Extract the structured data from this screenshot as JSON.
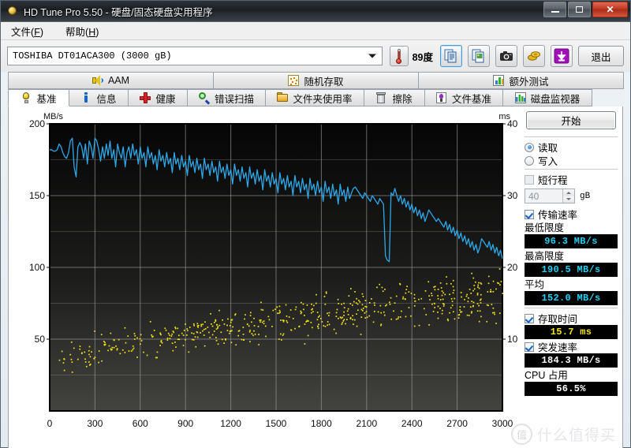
{
  "window": {
    "title": "HD Tune Pro 5.50 - 硬盘/固态硬盘实用程序",
    "icon": "bulb-icon",
    "minimize_label": "–",
    "maximize_label": "□",
    "close_label": "✕"
  },
  "menu": {
    "items": [
      {
        "label": "文件",
        "accel": "F"
      },
      {
        "label": "帮助",
        "accel": "H"
      }
    ]
  },
  "toolbar": {
    "drive": "TOSHIBA  DT01ACA300  (3000  gB)",
    "temperature": "89度",
    "buttons": [
      {
        "name": "copy-icon",
        "glyph": "copy"
      },
      {
        "name": "copy-image-icon",
        "glyph": "copy-image"
      },
      {
        "name": "screenshot-camera-icon",
        "glyph": "camera"
      },
      {
        "name": "coins-icon",
        "glyph": "coins"
      },
      {
        "name": "download-icon",
        "glyph": "download"
      }
    ],
    "exit_label": "退出"
  },
  "tabs": {
    "top_row": [
      {
        "label": "AAM",
        "icon": "speaker-icon",
        "active": false
      },
      {
        "label": "随机存取",
        "icon": "random-access-icon",
        "active": false
      },
      {
        "label": "额外测试",
        "icon": "extra-tests-icon",
        "active": false
      }
    ],
    "bottom_row": [
      {
        "label": "基准",
        "icon": "bulb-icon",
        "active": true
      },
      {
        "label": "信息",
        "icon": "info-icon",
        "active": false
      },
      {
        "label": "健康",
        "icon": "health-cross-icon",
        "active": false
      },
      {
        "label": "错误扫描",
        "icon": "magnifier-icon",
        "active": false
      },
      {
        "label": "文件夹使用率",
        "icon": "folder-icon",
        "active": false
      },
      {
        "label": "擦除",
        "icon": "trash-icon",
        "active": false
      },
      {
        "label": "文件基准",
        "icon": "file-benchmark-icon",
        "active": false
      },
      {
        "label": "磁盘监视器",
        "icon": "disk-monitor-icon",
        "active": false
      }
    ]
  },
  "panel": {
    "start_label": "开始",
    "mode_read": "读取",
    "mode_write": "写入",
    "mode_selected": "读取",
    "short_stroke_label": "短行程",
    "short_stroke_checked": false,
    "short_stroke_value": "40",
    "short_stroke_unit": "gB",
    "transfer_rate_label": "传输速率",
    "transfer_rate_checked": true,
    "min_label": "最低限度",
    "min_value": "96.3 MB/s",
    "max_label": "最高限度",
    "max_value": "190.5 MB/s",
    "avg_label": "平均",
    "avg_value": "152.0 MB/s",
    "access_time_label": "存取时间",
    "access_time_checked": true,
    "access_time_value": "15.7 ms",
    "burst_rate_label": "突发速率",
    "burst_rate_checked": true,
    "burst_rate_value": "184.3 MB/s",
    "cpu_label": "CPU 占用",
    "cpu_value": "56.5%"
  },
  "watermark": {
    "text": "什么值得买",
    "mark": "值"
  },
  "colors": {
    "transfer_line": "#2ca8e8",
    "access_dots": "#f2e219",
    "plot_bg_top": "#060606",
    "plot_bg_bottom": "#43433f",
    "grid": "#9a9a9a"
  },
  "chart_data": {
    "type": "line",
    "title": "",
    "xlabel": "",
    "ylabel": "MB/s",
    "y2label": "ms",
    "xlim": [
      0,
      3000
    ],
    "ylim": [
      0,
      200
    ],
    "y2lim": [
      0,
      40
    ],
    "grid": true,
    "xticks": [
      0,
      300,
      600,
      900,
      1200,
      1500,
      1800,
      2100,
      2400,
      2700,
      3000
    ],
    "yticks": [
      0,
      50,
      100,
      150,
      200
    ],
    "y2ticks": [
      0,
      10,
      20,
      30,
      40
    ],
    "series": [
      {
        "name": "传输速率",
        "axis": "left",
        "unit": "MB/s",
        "color": "#2ca8e8",
        "render": "line",
        "x": [
          0,
          12,
          25,
          37,
          50,
          62,
          75,
          87,
          100,
          112,
          125,
          137,
          150,
          162,
          175,
          187,
          200,
          212,
          225,
          237,
          250,
          262,
          275,
          287,
          300,
          312,
          325,
          337,
          350,
          362,
          375,
          387,
          400,
          412,
          425,
          437,
          450,
          462,
          475,
          487,
          500,
          512,
          525,
          537,
          550,
          562,
          575,
          587,
          600,
          612,
          625,
          637,
          650,
          662,
          675,
          687,
          700,
          712,
          725,
          737,
          750,
          762,
          775,
          787,
          800,
          812,
          825,
          837,
          850,
          862,
          875,
          887,
          900,
          912,
          925,
          937,
          950,
          962,
          975,
          987,
          1000,
          1012,
          1025,
          1037,
          1050,
          1062,
          1075,
          1087,
          1100,
          1112,
          1125,
          1137,
          1150,
          1162,
          1175,
          1187,
          1200,
          1212,
          1225,
          1237,
          1250,
          1262,
          1275,
          1287,
          1300,
          1312,
          1325,
          1337,
          1350,
          1362,
          1375,
          1387,
          1400,
          1412,
          1425,
          1437,
          1450,
          1462,
          1475,
          1487,
          1500,
          1512,
          1525,
          1537,
          1550,
          1562,
          1575,
          1587,
          1600,
          1612,
          1625,
          1637,
          1650,
          1662,
          1675,
          1687,
          1700,
          1712,
          1725,
          1737,
          1750,
          1762,
          1775,
          1787,
          1800,
          1812,
          1825,
          1837,
          1850,
          1862,
          1875,
          1887,
          1900,
          1912,
          1925,
          1937,
          1950,
          1962,
          1975,
          1987,
          2000,
          2012,
          2025,
          2037,
          2050,
          2062,
          2075,
          2087,
          2100,
          2112,
          2125,
          2137,
          2150,
          2162,
          2175,
          2187,
          2200,
          2212,
          2225,
          2237,
          2250,
          2262,
          2275,
          2287,
          2300,
          2312,
          2325,
          2337,
          2350,
          2362,
          2375,
          2387,
          2400,
          2412,
          2425,
          2437,
          2450,
          2462,
          2475,
          2487,
          2500,
          2512,
          2525,
          2537,
          2550,
          2562,
          2575,
          2587,
          2600,
          2612,
          2625,
          2637,
          2650,
          2662,
          2675,
          2687,
          2700,
          2712,
          2725,
          2737,
          2750,
          2762,
          2775,
          2787,
          2800,
          2812,
          2825,
          2837,
          2850,
          2862,
          2875,
          2887,
          2900,
          2912,
          2925,
          2937,
          2950,
          2962,
          2975,
          2987,
          3000
        ],
        "values": [
          182,
          182,
          181,
          181,
          182,
          186,
          184,
          180,
          177,
          176,
          180,
          188,
          190,
          170,
          163,
          184,
          187,
          184,
          176,
          186,
          172,
          188,
          184,
          176,
          190,
          188,
          182,
          174,
          184,
          176,
          186,
          178,
          188,
          176,
          182,
          170,
          186,
          180,
          176,
          184,
          170,
          180,
          184,
          176,
          186,
          178,
          182,
          172,
          184,
          176,
          180,
          170,
          184,
          176,
          180,
          172,
          178,
          168,
          182,
          174,
          178,
          170,
          180,
          172,
          176,
          166,
          180,
          172,
          176,
          168,
          178,
          170,
          174,
          164,
          178,
          170,
          174,
          166,
          176,
          168,
          172,
          162,
          176,
          168,
          172,
          164,
          174,
          166,
          170,
          160,
          174,
          166,
          170,
          162,
          172,
          164,
          168,
          158,
          172,
          164,
          168,
          160,
          170,
          162,
          166,
          156,
          170,
          162,
          166,
          158,
          168,
          160,
          164,
          154,
          168,
          160,
          164,
          156,
          166,
          158,
          162,
          152,
          166,
          158,
          162,
          154,
          164,
          156,
          160,
          150,
          164,
          156,
          160,
          152,
          162,
          154,
          158,
          148,
          162,
          154,
          158,
          150,
          160,
          152,
          156,
          146,
          160,
          152,
          156,
          148,
          158,
          150,
          154,
          144,
          158,
          150,
          154,
          146,
          156,
          148,
          152,
          155,
          156,
          154,
          152,
          150,
          148,
          152,
          150,
          148,
          146,
          150,
          148,
          146,
          144,
          148,
          146,
          144,
          108,
          105,
          104,
          152,
          150,
          155,
          150,
          146,
          150,
          144,
          148,
          142,
          146,
          140,
          144,
          138,
          142,
          136,
          140,
          134,
          138,
          132,
          136,
          140,
          138,
          136,
          134,
          132,
          134,
          132,
          130,
          128,
          132,
          126,
          130,
          124,
          128,
          122,
          126,
          120,
          124,
          118,
          122,
          116,
          120,
          114,
          118,
          112,
          116,
          110,
          114,
          120,
          118,
          116,
          114,
          118,
          112,
          116,
          110,
          114,
          108,
          112,
          106,
          110,
          104,
          108,
          102,
          106,
          100,
          104,
          98,
          102,
          97,
          100,
          98,
          97
        ]
      },
      {
        "name": "存取时间",
        "axis": "right",
        "unit": "ms",
        "color": "#f2e219",
        "render": "scatter",
        "note": "scatter cloud rising from ~5 ms near LBA 0 to ~16 ms near LBA 3000, mean 15.7 ms"
      }
    ]
  }
}
